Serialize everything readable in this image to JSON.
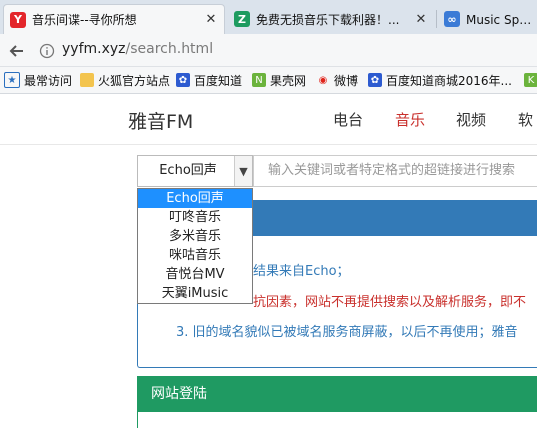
{
  "tabs": [
    {
      "title": "音乐间谍--寻你所想",
      "favicon": "Y",
      "active": true
    },
    {
      "title": "免费无损音乐下载利器！...",
      "favicon": "Z",
      "active": false
    },
    {
      "title": "Music Spy_免",
      "favicon": "∞",
      "active": false
    }
  ],
  "navigation": {
    "url_host": "yyfm.xyz",
    "url_path": "/search.html"
  },
  "bookmarks": [
    {
      "label": "最常访问",
      "icon": "bookmark-star-icon"
    },
    {
      "label": "火狐官方站点",
      "icon": "folder-icon"
    },
    {
      "label": "百度知道",
      "icon": "paw-icon"
    },
    {
      "label": "果壳网",
      "icon": "guokr-icon"
    },
    {
      "label": "微博",
      "icon": "weibo-icon"
    },
    {
      "label": "百度知道商城2016年...",
      "icon": "paw-icon"
    }
  ],
  "site": {
    "brand": "雅音FM",
    "nav": [
      "电台",
      "音乐",
      "视频",
      "软"
    ],
    "active_nav": "音乐"
  },
  "search": {
    "selected_source": "Echo回声",
    "placeholder": "输入关键词或者特定格式的超链接进行搜索",
    "options": [
      "Echo回声",
      "叮咚音乐",
      "多米音乐",
      "咪咕音乐",
      "音悦台MV",
      "天翼iMusic"
    ]
  },
  "notice": {
    "line1": "结果来自Echo；",
    "line2": "抗因素，网站不再提供搜索以及解析服务，即不",
    "line3": "3. 旧的域名貌似已被域名服务商屏蔽，以后不再使用；雅音"
  },
  "login": {
    "title": "网站登陆"
  },
  "colors": {
    "primary": "#337ab7",
    "success": "#1f9a62",
    "danger": "#c9302c",
    "highlight": "#1e90ff"
  }
}
